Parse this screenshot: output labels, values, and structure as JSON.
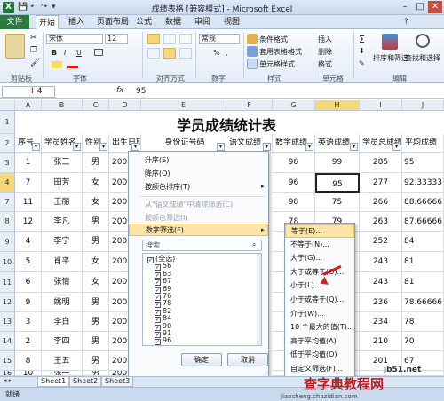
{
  "window": {
    "title": "成绩表格 [兼容模式] - Microsoft Excel",
    "logo": "X"
  },
  "tabs": {
    "file": "文件",
    "items": [
      "开始",
      "插入",
      "页面布局",
      "公式",
      "数据",
      "审阅",
      "视图"
    ]
  },
  "ribbon": {
    "font_name": "宋体",
    "font_size": "12",
    "bold": "B",
    "italic": "I",
    "underline": "U",
    "number_format": "常规",
    "percent": "%",
    "comma": ",",
    "cond_format": "条件格式",
    "table_format": "套用表格格式",
    "cell_style": "单元格样式",
    "insert": "插入",
    "delete": "删除",
    "format": "格式",
    "sort_filter": "排序和筛选",
    "find_select": "查找和选择",
    "groups": {
      "clipboard": "剪贴板",
      "font": "字体",
      "align": "对齐方式",
      "number": "数字",
      "styles": "样式",
      "cells": "单元格",
      "edit": "编辑"
    }
  },
  "formula_bar": {
    "cell": "H4",
    "fx": "fx",
    "value": "95"
  },
  "columns": [
    "A",
    "B",
    "C",
    "D",
    "E",
    "F",
    "G",
    "H",
    "I",
    "J"
  ],
  "rows": [
    "1",
    "2",
    "3",
    "4",
    "5",
    "6",
    "7",
    "8",
    "9",
    "10",
    "11",
    "12",
    "13",
    "14",
    "15",
    "16"
  ],
  "sheet": {
    "title": "学员成绩统计表",
    "headers": [
      "序号",
      "学员姓名",
      "性别",
      "出生日期",
      "身份证号码",
      "语文成绩",
      "数学成绩",
      "英语成绩",
      "学员总成绩",
      "平均成绩"
    ],
    "data": [
      [
        "1",
        "张三",
        "男",
        "200",
        "98",
        "99",
        "285",
        "95"
      ],
      [
        "7",
        "田芳",
        "女",
        "200",
        "96",
        "95",
        "277",
        "92.33333"
      ],
      [
        "11",
        "王丽",
        "女",
        "200",
        "98",
        "75",
        "266",
        "88.66666"
      ],
      [
        "12",
        "李凡",
        "男",
        "200",
        "78",
        "79",
        "263",
        "87.66666"
      ],
      [
        "4",
        "李宁",
        "男",
        "200",
        "",
        "",
        "252",
        "84"
      ],
      [
        "5",
        "肖平",
        "女",
        "200",
        "",
        "",
        "243",
        "81"
      ],
      [
        "6",
        "张倩",
        "女",
        "200",
        "",
        "",
        "243",
        "81"
      ],
      [
        "9",
        "姚明",
        "男",
        "200",
        "",
        "",
        "236",
        "78.66666"
      ],
      [
        "3",
        "李白",
        "男",
        "200",
        "",
        "",
        "234",
        "78"
      ],
      [
        "2",
        "李四",
        "男",
        "200",
        "",
        "",
        "210",
        "70"
      ],
      [
        "8",
        "王五",
        "男",
        "200",
        "",
        "",
        "201",
        "67"
      ],
      [
        "10",
        "张一",
        "男",
        "200",
        "",
        "",
        "",
        ""
      ]
    ]
  },
  "filter_menu": {
    "items": [
      "升序(S)",
      "降序(O)",
      "按颜色排序(T)",
      "从\"语文成绩\"中清除筛选(C)",
      "按颜色筛选(I)",
      "数字筛选(F)"
    ],
    "search_placeholder": "搜索",
    "values": [
      "(全选)",
      "56",
      "63",
      "67",
      "69",
      "76",
      "78",
      "82",
      "84",
      "90",
      "91",
      "96"
    ],
    "ok": "确定",
    "cancel": "取消"
  },
  "number_filter_submenu": [
    "等于(E)...",
    "不等于(N)...",
    "大于(G)...",
    "大于或等于(O)...",
    "小于(L)...",
    "小于或等于(Q)...",
    "介于(W)...",
    "10 个最大的值(T)...",
    "高于平均值(A)",
    "低于平均值(O)",
    "自定义筛选(F)..."
  ],
  "sheet_tabs": [
    "Sheet1",
    "Sheet2",
    "Sheet3"
  ],
  "status": {
    "ready": "就绪"
  },
  "watermark": {
    "site": "jb51.net",
    "text": "查字典教程网",
    "url": "jiaocheng.chazidian.com"
  },
  "colors": {
    "excel_green": "#1f7a3a",
    "highlight": "#fbe4a6",
    "arrow": "#d42020"
  }
}
